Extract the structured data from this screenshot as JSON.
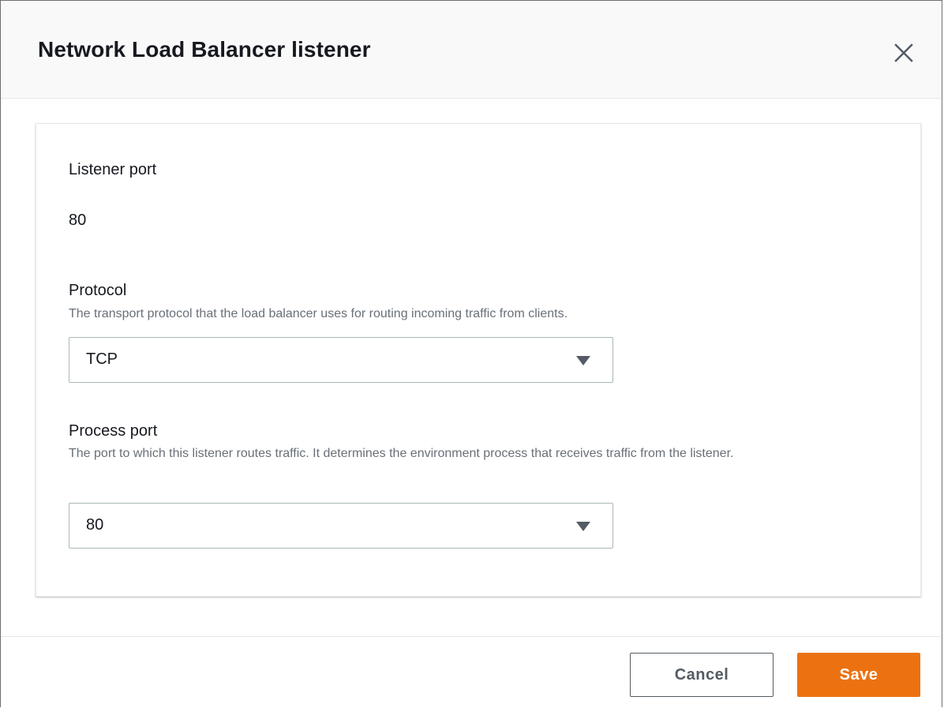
{
  "dialog": {
    "title": "Network Load Balancer listener",
    "close_icon": "close-icon"
  },
  "listener_port": {
    "label": "Listener port",
    "value": "80"
  },
  "protocol": {
    "label": "Protocol",
    "description": "The transport protocol that the load balancer uses for routing incoming traffic from clients.",
    "selected": "TCP",
    "caret_icon": "caret-down-icon"
  },
  "process_port": {
    "label": "Process port",
    "description": "The port to which this listener routes traffic. It determines the environment process that receives traffic from the listener.",
    "selected": "80",
    "caret_icon": "caret-down-icon"
  },
  "footer": {
    "cancel_label": "Cancel",
    "save_label": "Save"
  },
  "colors": {
    "primary_button": "#ec7211",
    "text": "#16191f",
    "description_text": "#687078",
    "border": "#aab7b8"
  }
}
